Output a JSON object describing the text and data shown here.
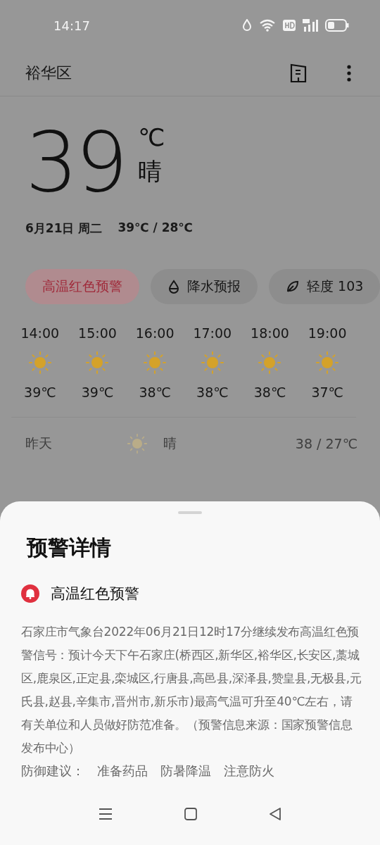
{
  "status_bar": {
    "time": "14:17"
  },
  "header": {
    "title": "裕华区"
  },
  "current": {
    "temperature": "39",
    "unit": "℃",
    "condition": "晴",
    "date": "6月21日 周二",
    "high_low": "39℃ / 28℃"
  },
  "chips": [
    {
      "kind": "alert",
      "label": "高温红色预警"
    },
    {
      "kind": "rain",
      "label": "降水预报"
    },
    {
      "kind": "air",
      "label": "轻度 103"
    }
  ],
  "hourly": [
    {
      "time": "14:00",
      "temp": "39℃"
    },
    {
      "time": "15:00",
      "temp": "39℃"
    },
    {
      "time": "16:00",
      "temp": "38℃"
    },
    {
      "time": "17:00",
      "temp": "38℃"
    },
    {
      "time": "18:00",
      "temp": "38℃"
    },
    {
      "time": "19:00",
      "temp": "37℃"
    }
  ],
  "daily": [
    {
      "day": "昨天",
      "condition": "晴",
      "range": "38 / 27℃"
    }
  ],
  "sheet": {
    "title": "预警详情",
    "alert_title": "高温红色预警",
    "body": "石家庄市气象台2022年06月21日12时17分继续发布高温红色预警信号：预计今天下午石家庄(桥西区,新华区,裕华区,长安区,藁城区,鹿泉区,正定县,栾城区,行唐县,高邑县,深泽县,赞皇县,无极县,元氏县,赵县,辛集市,晋州市,新乐市)最高气温可升至40℃左右，请有关单位和人员做好防范准备。（预警信息来源：国家预警信息发布中心）",
    "advice_label": "防御建议：",
    "advice": [
      "准备药品",
      "防暑降温",
      "注意防火"
    ]
  }
}
